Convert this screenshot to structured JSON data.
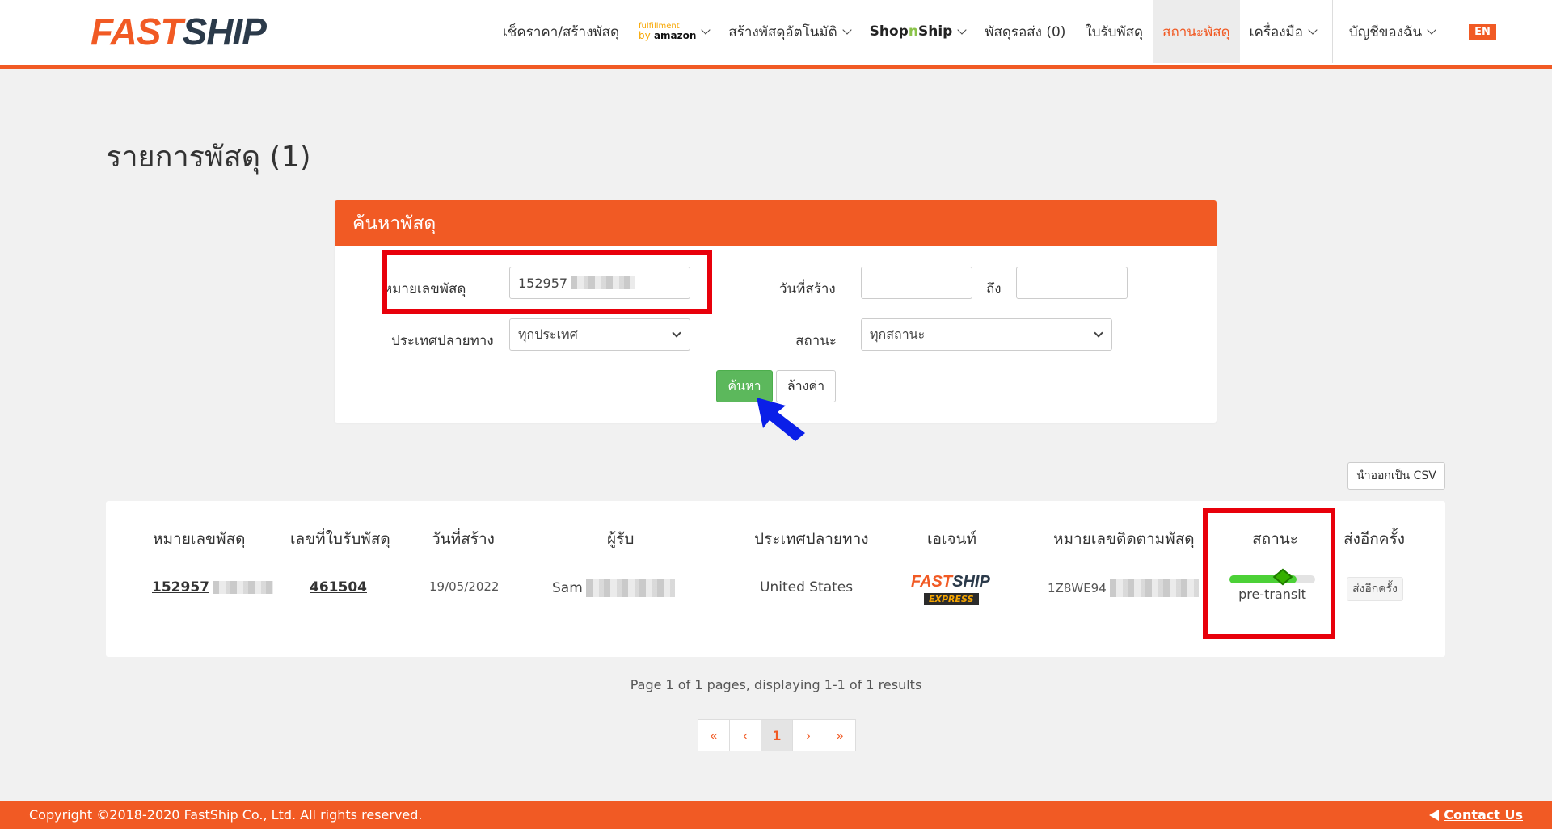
{
  "brand": {
    "part1": "FAST",
    "part2": "SHIP",
    "accent": "#f15a24",
    "dark": "#2b3a4a"
  },
  "nav": {
    "items": [
      {
        "label": "เช็คราคา/สร้างพัสดุ"
      },
      {
        "label": "Amazon fulfillment"
      },
      {
        "label": "สร้างพัสดุอัตโนมัติ"
      },
      {
        "label": "ShopnShip"
      },
      {
        "label": "พัสดุรอส่ง (0)"
      },
      {
        "label": "ใบรับพัสดุ"
      },
      {
        "label": "สถานะพัสดุ"
      },
      {
        "label": "เครื่องมือ"
      },
      {
        "label": "บัญชีของฉัน"
      }
    ],
    "amazon_ff": "fulfillment",
    "amazon_by": "by",
    "amazon_name": "amazon",
    "snp_a": "Shop",
    "snp_n": "n",
    "snp_b": "Ship",
    "lang": "EN"
  },
  "page_title": "รายการพัสดุ (1)",
  "search": {
    "heading": "ค้นหาพัสดุ",
    "parcel_no_label": "หมายเลขพัสดุ",
    "parcel_no_value": "152957",
    "created_label": "วันที่สร้าง",
    "to_label": "ถึง",
    "country_label": "ประเทศปลายทาง",
    "country_value": "ทุกประเทศ",
    "status_label": "สถานะ",
    "status_value": "ทุกสถานะ",
    "search_button": "ค้นหา",
    "clear_button": "ล้างค่า"
  },
  "export_csv": "นำออกเป็น CSV",
  "table": {
    "headers": [
      "หมายเลขพัสดุ",
      "เลขที่ใบรับพัสดุ",
      "วันที่สร้าง",
      "ผู้รับ",
      "ประเทศปลายทาง",
      "เอเจนท์",
      "หมายเลขติดตามพัสดุ",
      "สถานะ",
      "ส่งอีกครั้ง"
    ],
    "rows": [
      {
        "parcel_no": "152957",
        "receipt_no": "461504",
        "created": "19/05/2022",
        "recipient": "Sam",
        "country": "United States",
        "agent_a": "FAST",
        "agent_b": "SHIP",
        "agent_c": "EXPRESS",
        "tracking": "1Z8WE94",
        "status": "pre-transit",
        "status_progress": 0.78,
        "resend": "ส่งอีกครั้ง"
      }
    ]
  },
  "pagination": {
    "info": "Page 1 of 1 pages, displaying 1-1 of 1 results",
    "first": "«",
    "prev": "‹",
    "current": "1",
    "next": "›",
    "last": "»"
  },
  "footer": {
    "copyright": "Copyright ©2018-2020 FastShip Co., Ltd. All rights reserved.",
    "contact": "Contact Us"
  }
}
